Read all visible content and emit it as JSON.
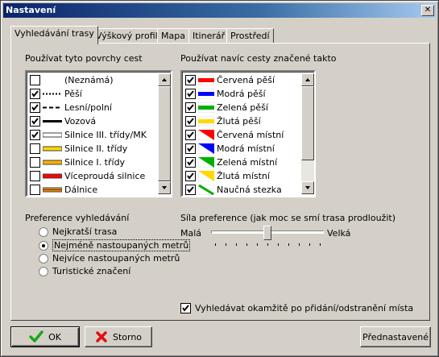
{
  "window": {
    "title": "Nastavení",
    "close_glyph": "✕"
  },
  "tabs": [
    {
      "label": "Vyhledávání trasy",
      "active": true
    },
    {
      "label": "Výškový profil"
    },
    {
      "label": "Mapa"
    },
    {
      "label": "Itinerář"
    },
    {
      "label": "Prostředí"
    }
  ],
  "surfaces": {
    "title": "Používat tyto povrchy cest",
    "items": [
      {
        "label": "(Neznámá)",
        "checked": false,
        "swatch": "none"
      },
      {
        "label": "Pěší",
        "checked": true,
        "swatch": "dotted"
      },
      {
        "label": "Lesní/polní",
        "checked": true,
        "swatch": "dashed"
      },
      {
        "label": "Vozová",
        "checked": true,
        "swatch": "solid-black"
      },
      {
        "label": "Silnice III. třídy/MK",
        "checked": true,
        "swatch": "road-white"
      },
      {
        "label": "Silnice II. třídy",
        "checked": false,
        "swatch": "road-yellow"
      },
      {
        "label": "Silnice I. třídy",
        "checked": false,
        "swatch": "road-orange"
      },
      {
        "label": "Víceproudá silnice",
        "checked": false,
        "swatch": "road-red"
      },
      {
        "label": "Dálnice",
        "checked": false,
        "swatch": "road-double"
      }
    ]
  },
  "marked": {
    "title": "Používat navíc cesty značené takto",
    "items": [
      {
        "label": "Červená pěší",
        "checked": true,
        "color": "#ff0000",
        "kind": "stripe"
      },
      {
        "label": "Modrá pěší",
        "checked": true,
        "color": "#0000ff",
        "kind": "stripe"
      },
      {
        "label": "Zelená pěší",
        "checked": true,
        "color": "#00b000",
        "kind": "stripe"
      },
      {
        "label": "Žlutá pěší",
        "checked": true,
        "color": "#ffd800",
        "kind": "stripe"
      },
      {
        "label": "Červená místní",
        "checked": true,
        "color": "#ff0000",
        "kind": "triangle"
      },
      {
        "label": "Modrá místní",
        "checked": true,
        "color": "#0000ff",
        "kind": "triangle"
      },
      {
        "label": "Zelená místní",
        "checked": true,
        "color": "#00b000",
        "kind": "triangle"
      },
      {
        "label": "Žlutá místní",
        "checked": true,
        "color": "#ffd800",
        "kind": "triangle"
      },
      {
        "label": "Naučná stezka",
        "checked": true,
        "color": "#00b000",
        "kind": "diagonal"
      }
    ]
  },
  "preference": {
    "title": "Preference vyhledávání",
    "options": [
      {
        "label": "Nejkratší trasa",
        "checked": false
      },
      {
        "label": "Nejméně nastoupaných metrů",
        "checked": true
      },
      {
        "label": "Nejvíce nastoupaných metrů",
        "checked": false
      },
      {
        "label": "Turistické značení",
        "checked": false
      }
    ]
  },
  "strength": {
    "title": "Síla preference (jak moc se smí trasa prodloužit)",
    "min_label": "Malá",
    "max_label": "Velká",
    "value": 0.5
  },
  "auto_search": {
    "label": "Vyhledávat okamžitě po přidání/odstranění místa",
    "checked": true
  },
  "buttons": {
    "ok": "OK",
    "cancel": "Storno",
    "defaults": "Přednastavené"
  },
  "colors": {
    "title_bar": "#0a246a",
    "face": "#d4d0c8"
  },
  "icons": {
    "ok": "check-icon",
    "cancel": "cross-icon"
  }
}
